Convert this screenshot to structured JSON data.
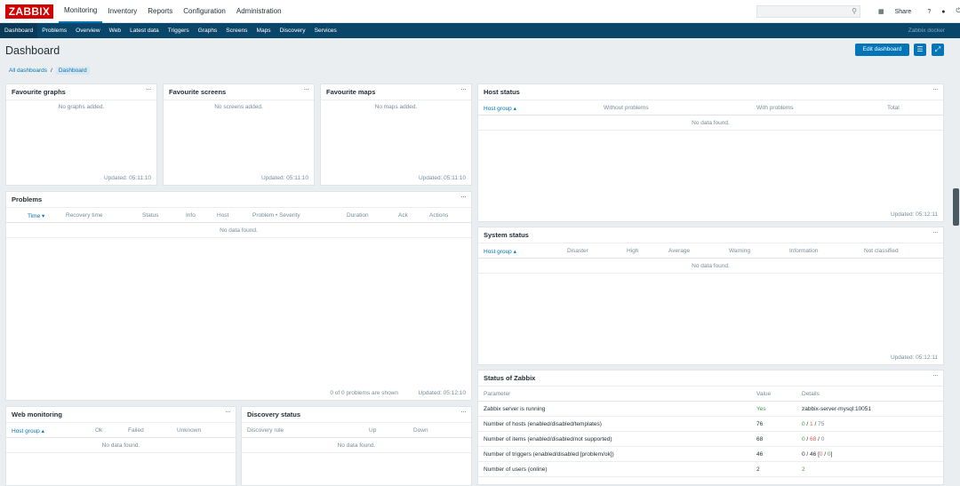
{
  "app": {
    "logo": "ZABBIX",
    "brand": "Zabbix docker"
  },
  "main_menu": [
    {
      "label": "Monitoring"
    },
    {
      "label": "Inventory"
    },
    {
      "label": "Reports"
    },
    {
      "label": "Configuration"
    },
    {
      "label": "Administration"
    }
  ],
  "search": {
    "placeholder": ""
  },
  "top_icons": {
    "share": "Share",
    "help": "?",
    "user": "user-icon",
    "signout": "power-icon"
  },
  "sub_menu": [
    {
      "label": "Dashboard"
    },
    {
      "label": "Problems"
    },
    {
      "label": "Overview"
    },
    {
      "label": "Web"
    },
    {
      "label": "Latest data"
    },
    {
      "label": "Triggers"
    },
    {
      "label": "Graphs"
    },
    {
      "label": "Screens"
    },
    {
      "label": "Maps"
    },
    {
      "label": "Discovery"
    },
    {
      "label": "Services"
    }
  ],
  "page": {
    "title": "Dashboard",
    "edit_button": "Edit dashboard"
  },
  "breadcrumb": {
    "all": "All dashboards",
    "sep": "/",
    "current": "Dashboard"
  },
  "widgets": {
    "fav_graphs": {
      "title": "Favourite graphs",
      "empty": "No graphs added.",
      "updated": "Updated: 05:11:10"
    },
    "fav_screens": {
      "title": "Favourite screens",
      "empty": "No screens added.",
      "updated": "Updated: 05:11:10"
    },
    "fav_maps": {
      "title": "Favourite maps",
      "empty": "No maps added.",
      "updated": "Updated: 05:11:10"
    },
    "problems": {
      "title": "Problems",
      "headers": [
        "Time ▾",
        "Recovery time",
        "Status",
        "Info",
        "Host",
        "Problem • Severity",
        "Duration",
        "Ack",
        "Actions"
      ],
      "empty": "No data found.",
      "summary": "0 of 0 problems are shown",
      "updated": "Updated: 05:12:10"
    },
    "host_status": {
      "title": "Host status",
      "headers": [
        "Host group ▴",
        "Without problems",
        "With problems",
        "Total"
      ],
      "empty": "No data found.",
      "updated": "Updated: 05:12:11"
    },
    "system_status": {
      "title": "System status",
      "headers": [
        "Host group ▴",
        "Disaster",
        "High",
        "Average",
        "Warning",
        "Information",
        "Not classified"
      ],
      "empty": "No data found.",
      "updated": "Updated: 05:12:11"
    },
    "zabbix_status": {
      "title": "Status of Zabbix",
      "headers": [
        "Parameter",
        "Value",
        "Details"
      ],
      "rows": [
        {
          "param": "Zabbix server is running",
          "value": "Yes",
          "d1": "zabbix-server-mysql:10051",
          "d2": "",
          "d3": "",
          "d4": "",
          "d5": "",
          "d6": ""
        },
        {
          "param": "Number of hosts (enabled/disabled/templates)",
          "value": "76",
          "d1": "0",
          "d2": " / ",
          "d3": "1",
          "d4": " / ",
          "d5": "75",
          "d6": ""
        },
        {
          "param": "Number of items (enabled/disabled/not supported)",
          "value": "68",
          "d1": "0",
          "d2": " / ",
          "d3": "68",
          "d4": " / ",
          "d5": "0",
          "d6": ""
        },
        {
          "param": "Number of triggers (enabled/disabled [problem/ok])",
          "value": "46",
          "d1": "0 / 46 [",
          "d2": "0",
          "d3": " / ",
          "d4": "0",
          "d5": "]",
          "d6": ""
        },
        {
          "param": "Number of users (online)",
          "value": "2",
          "d1": "2",
          "d2": "",
          "d3": "",
          "d4": "",
          "d5": "",
          "d6": ""
        }
      ]
    },
    "web_monitoring": {
      "title": "Web monitoring",
      "headers": [
        "Host group ▴",
        "Ok",
        "Failed",
        "Unknown"
      ],
      "empty": "No data found."
    },
    "discovery_status": {
      "title": "Discovery status",
      "headers": [
        "Discovery rule",
        "Up",
        "Down"
      ],
      "empty": "No data found."
    }
  },
  "dots": "···"
}
